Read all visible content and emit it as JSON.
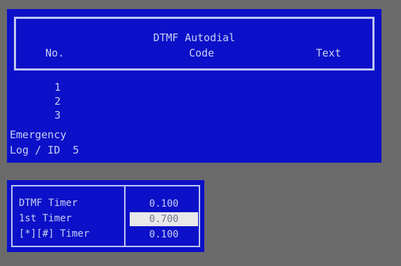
{
  "autodial": {
    "title": "DTMF Autodial",
    "columns": {
      "no": "No.",
      "code": "Code",
      "text": "Text"
    },
    "entries": [
      {
        "no": "1"
      },
      {
        "no": "2"
      },
      {
        "no": "3"
      }
    ],
    "emergency_label": "Emergency",
    "log_id_label": "Log / ID  5"
  },
  "timers": [
    {
      "label": "DTMF Timer",
      "value": "0.100",
      "selected": false
    },
    {
      "label": "1st Timer",
      "value": "0.700",
      "selected": true
    },
    {
      "label": "[*][#] Timer",
      "value": "0.100",
      "selected": false
    }
  ],
  "colors": {
    "panel": "#0c10c8",
    "background": "#6b6b6b",
    "text": "#c8d0f0",
    "highlight": "#e8e8e8"
  }
}
